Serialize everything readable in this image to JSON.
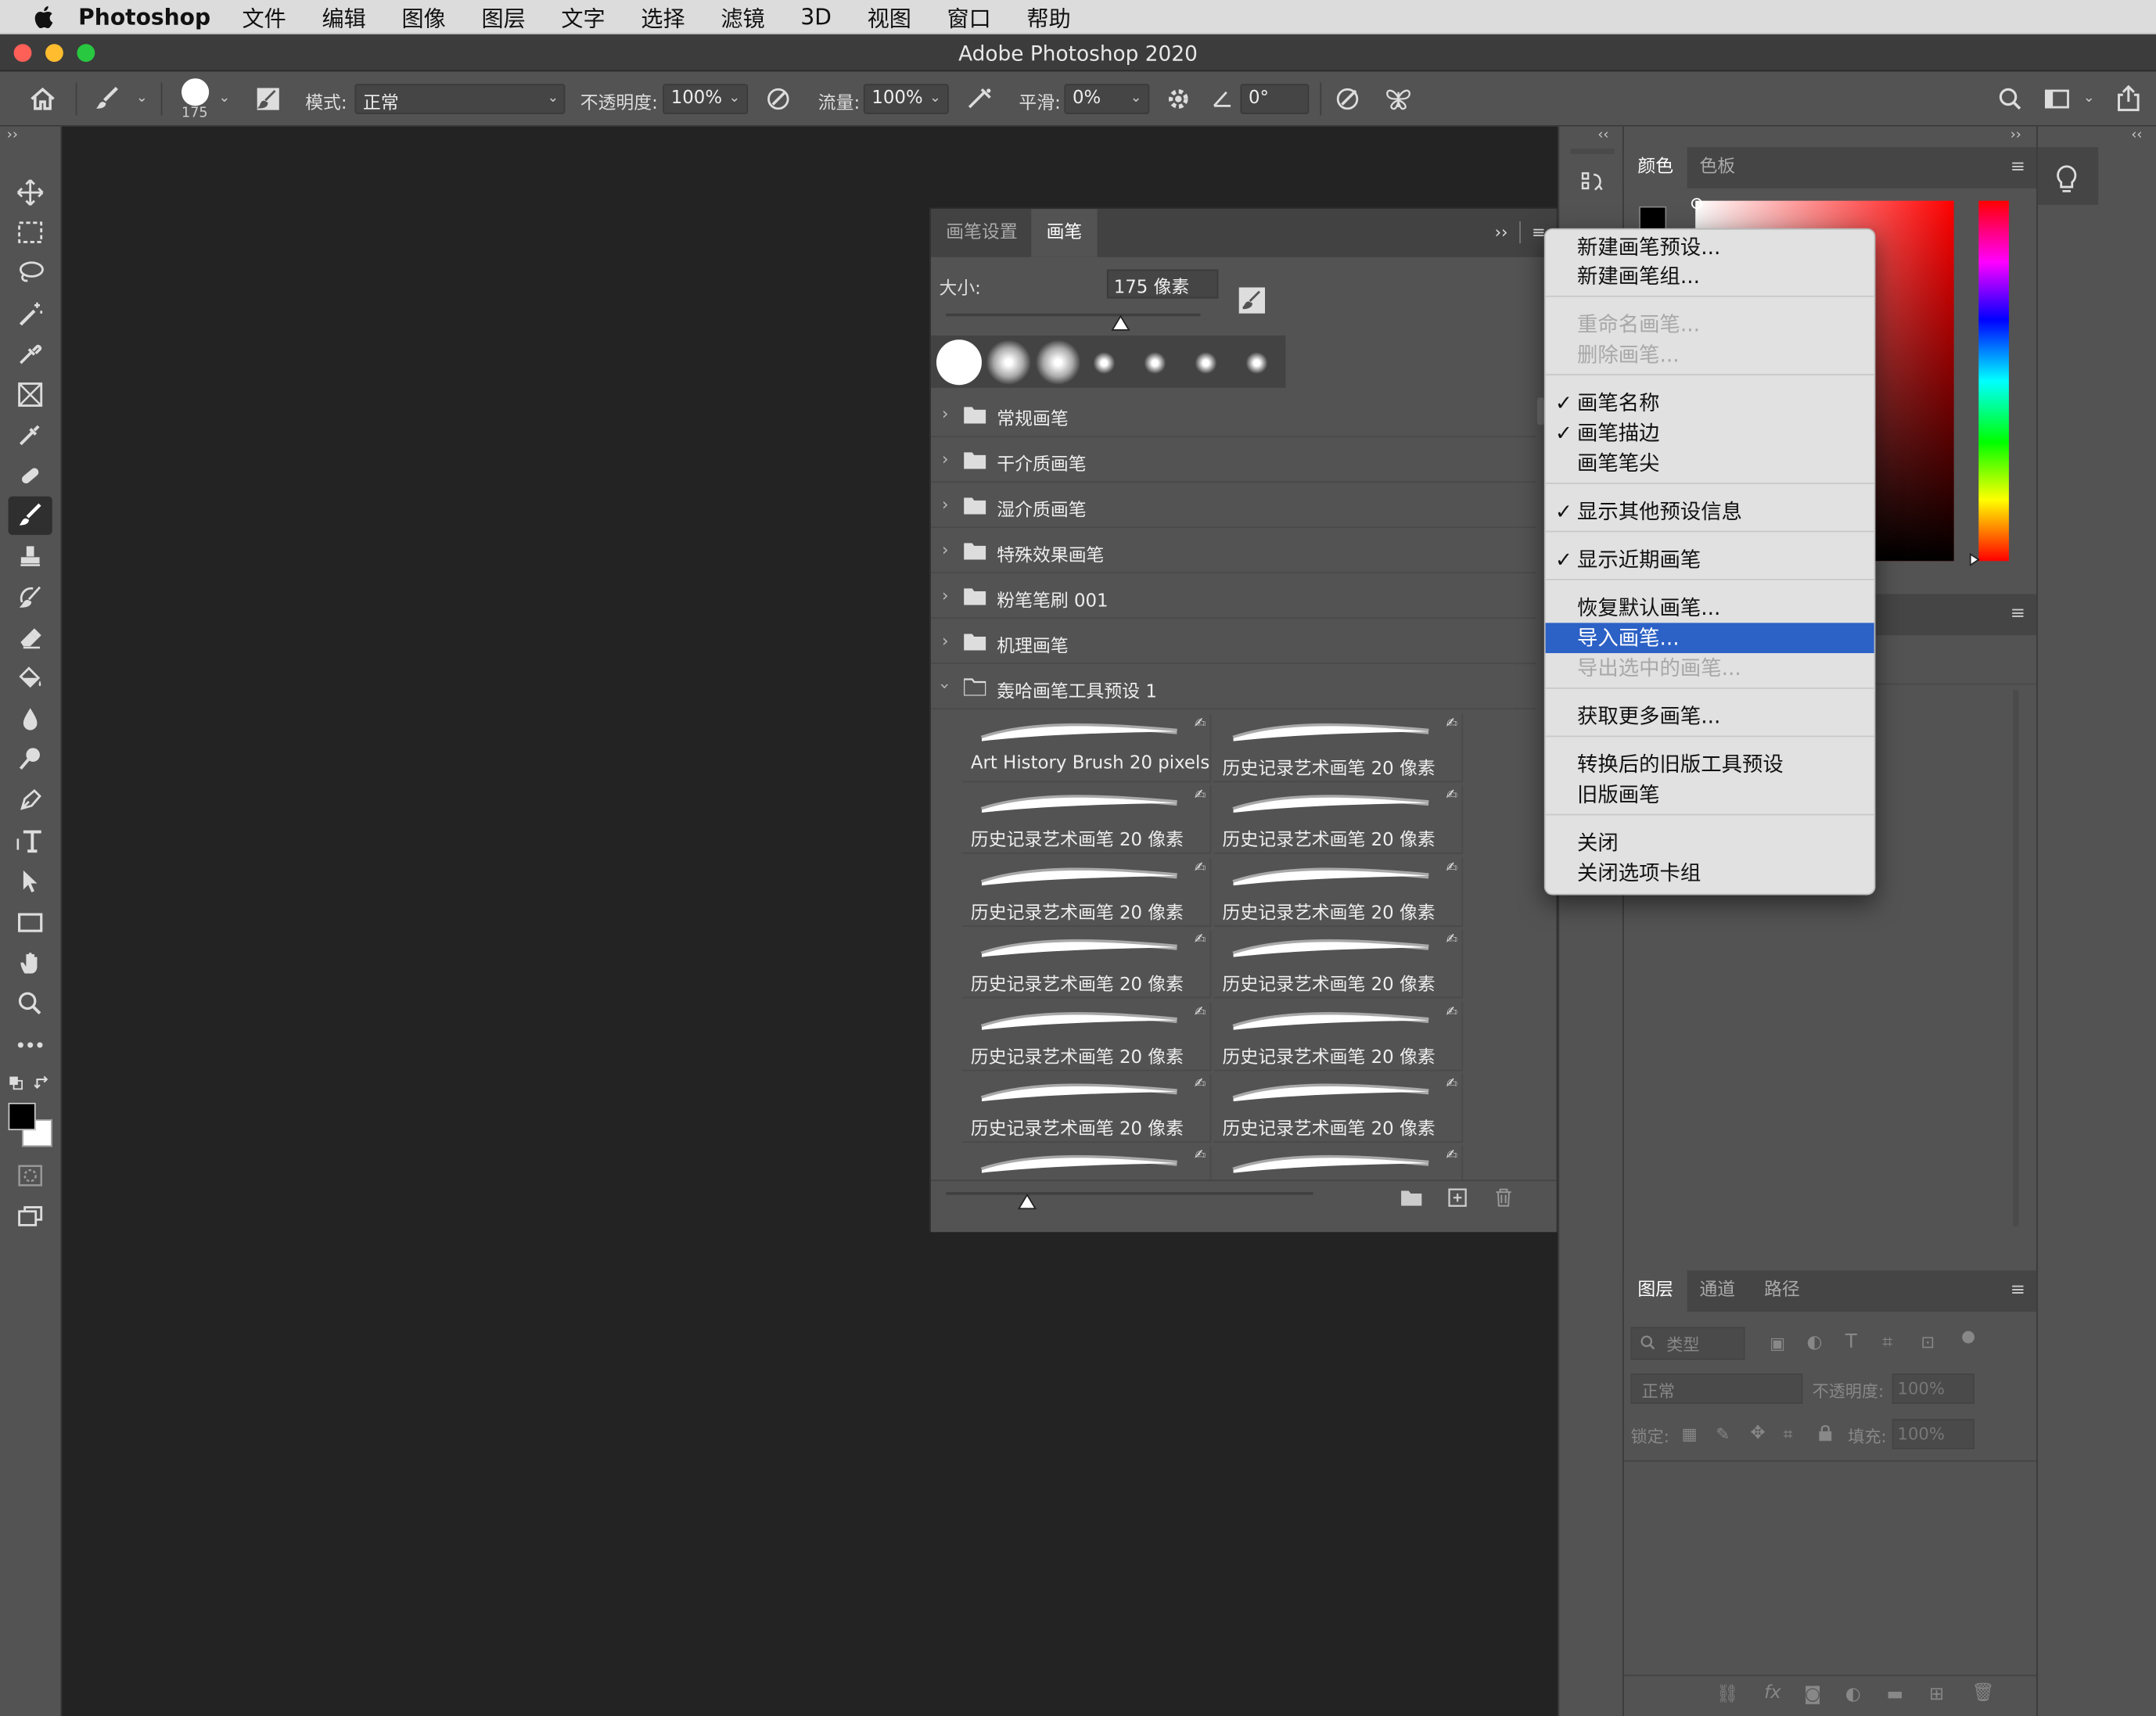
{
  "menubar": {
    "app": "Photoshop",
    "items": [
      "文件",
      "编辑",
      "图像",
      "图层",
      "文字",
      "选择",
      "滤镜",
      "3D",
      "视图",
      "窗口",
      "帮助"
    ]
  },
  "window": {
    "title": "Adobe Photoshop 2020"
  },
  "options": {
    "brush_size": "175",
    "mode_label": "模式:",
    "mode_value": "正常",
    "opacity_label": "不透明度:",
    "opacity_value": "100%",
    "flow_label": "流量:",
    "flow_value": "100%",
    "smooth_label": "平滑:",
    "smooth_value": "0%",
    "angle_value": "0°"
  },
  "brush_panel": {
    "tabs": [
      "画笔设置",
      "画笔"
    ],
    "size_label": "大小:",
    "size_value": "175 像素",
    "groups": [
      "常规画笔",
      "干介质画笔",
      "湿介质画笔",
      "特殊效果画笔",
      "粉笔笔刷 001",
      "机理画笔",
      "轰哈画笔工具预设 1"
    ],
    "brushes": [
      "Art History Brush 20 pixels",
      "历史记录艺术画笔 20 像素",
      "历史记录艺术画笔 20 像素",
      "历史记录艺术画笔 20 像素",
      "历史记录艺术画笔 20 像素",
      "历史记录艺术画笔 20 像素",
      "历史记录艺术画笔 20 像素",
      "历史记录艺术画笔 20 像素",
      "历史记录艺术画笔 20 像素",
      "历史记录艺术画笔 20 像素",
      "历史记录艺术画笔 20 像素",
      "历史记录艺术画笔 20 像素",
      "",
      ""
    ]
  },
  "context_menu": {
    "items": [
      {
        "label": "新建画笔预设...",
        "state": "normal"
      },
      {
        "label": "新建画笔组...",
        "state": "normal"
      },
      {
        "label": "重命名画笔...",
        "state": "disabled"
      },
      {
        "label": "删除画笔...",
        "state": "disabled"
      },
      {
        "label": "画笔名称",
        "state": "checked"
      },
      {
        "label": "画笔描边",
        "state": "checked"
      },
      {
        "label": "画笔笔尖",
        "state": "normal"
      },
      {
        "label": "显示其他预设信息",
        "state": "checked"
      },
      {
        "label": "显示近期画笔",
        "state": "checked"
      },
      {
        "label": "恢复默认画笔...",
        "state": "normal"
      },
      {
        "label": "导入画笔...",
        "state": "highlighted"
      },
      {
        "label": "导出选中的画笔...",
        "state": "disabled"
      },
      {
        "label": "获取更多画笔...",
        "state": "normal"
      },
      {
        "label": "转换后的旧版工具预设",
        "state": "normal"
      },
      {
        "label": "旧版画笔",
        "state": "normal"
      },
      {
        "label": "关闭",
        "state": "normal"
      },
      {
        "label": "关闭选项卡组",
        "state": "normal"
      }
    ]
  },
  "color_panel": {
    "tabs": [
      "颜色",
      "色板"
    ]
  },
  "layers_panel": {
    "tabs": [
      "图层",
      "通道",
      "路径"
    ],
    "filter_placeholder": "类型",
    "blend_mode": "正常",
    "opacity_label": "不透明度:",
    "opacity_value": "100%",
    "lock_label": "锁定:",
    "fill_label": "填充:",
    "fill_value": "100%"
  },
  "colors": {
    "highlight": "#2c61c6",
    "canvas": "#232323",
    "panel": "#535353"
  }
}
